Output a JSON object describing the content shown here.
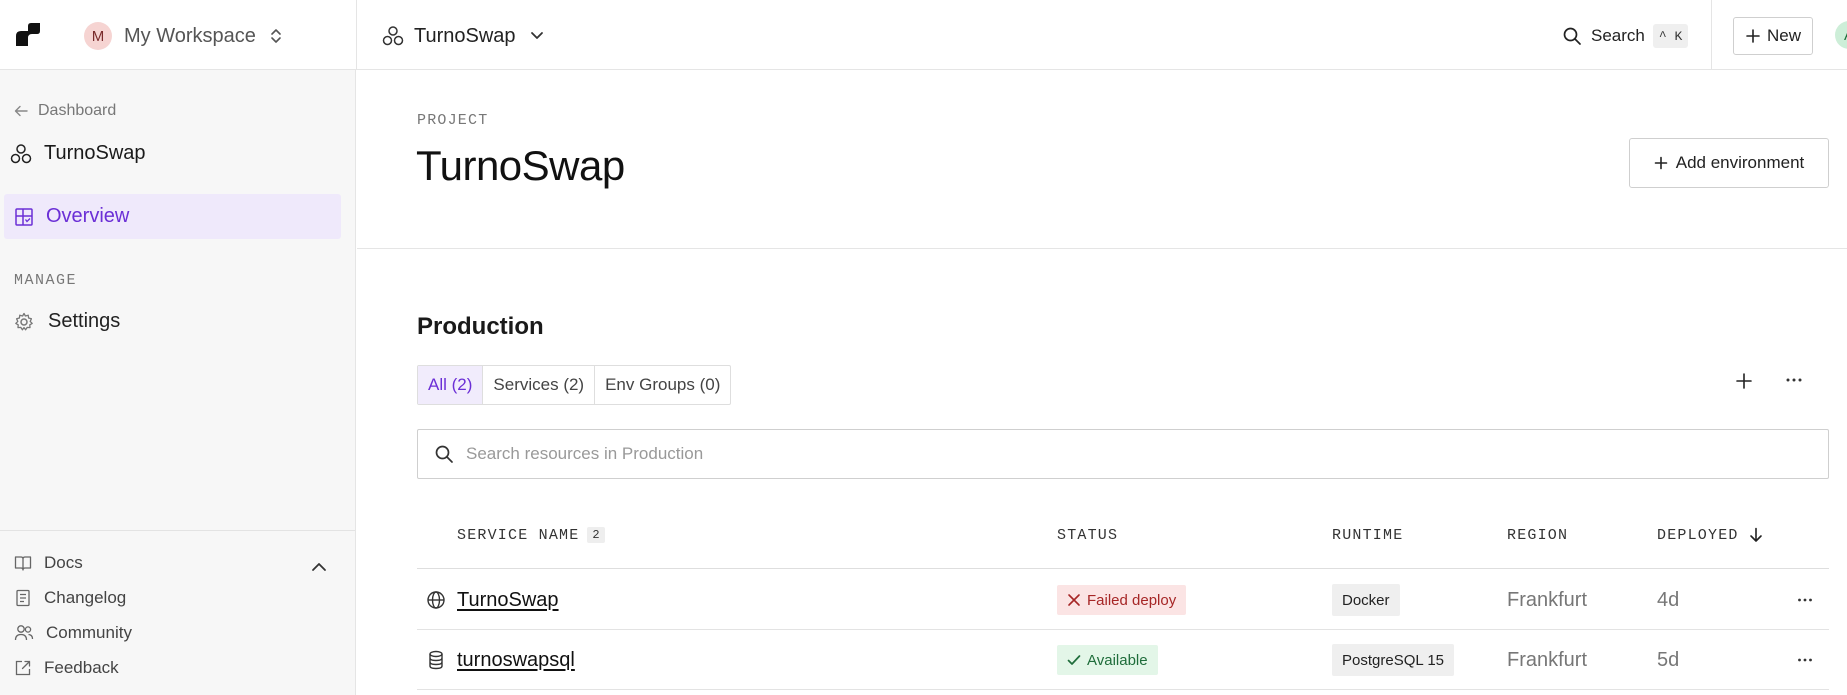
{
  "topbar": {
    "workspace_initial": "M",
    "workspace_name": "My Workspace",
    "project_name": "TurnoSwap",
    "search_label": "Search",
    "search_shortcut": "^ K",
    "new_label": "New",
    "user_initial": "A"
  },
  "sidebar": {
    "back_label": "Dashboard",
    "project_name": "TurnoSwap",
    "nav_overview": "Overview",
    "section_manage": "MANAGE",
    "nav_settings": "Settings",
    "footer": {
      "docs": "Docs",
      "changelog": "Changelog",
      "community": "Community",
      "feedback": "Feedback"
    }
  },
  "main": {
    "eyebrow": "PROJECT",
    "title": "TurnoSwap",
    "add_environment_label": "Add environment",
    "environment_title": "Production",
    "tabs": [
      {
        "label": "All (2)",
        "active": true
      },
      {
        "label": "Services (2)",
        "active": false
      },
      {
        "label": "Env Groups (0)",
        "active": false
      }
    ],
    "search_placeholder": "Search resources in Production",
    "table": {
      "headers": {
        "service_name": "SERVICE NAME",
        "service_count": "2",
        "status": "STATUS",
        "runtime": "RUNTIME",
        "region": "REGION",
        "deployed": "DEPLOYED"
      },
      "rows": [
        {
          "icon": "globe-icon",
          "name": "TurnoSwap",
          "status": "Failed deploy",
          "status_kind": "failed",
          "runtime": "Docker",
          "region": "Frankfurt",
          "deployed": "4d"
        },
        {
          "icon": "database-icon",
          "name": "turnoswapsql",
          "status": "Available",
          "status_kind": "available",
          "runtime": "PostgreSQL 15",
          "region": "Frankfurt",
          "deployed": "5d"
        }
      ]
    }
  },
  "colors": {
    "accent": "#6b2fd6",
    "accent_bg": "#efe9fb",
    "failed_fg": "#a62626",
    "failed_bg": "#fbe4e4",
    "available_fg": "#1f6d3b",
    "available_bg": "#e3f6e8"
  }
}
